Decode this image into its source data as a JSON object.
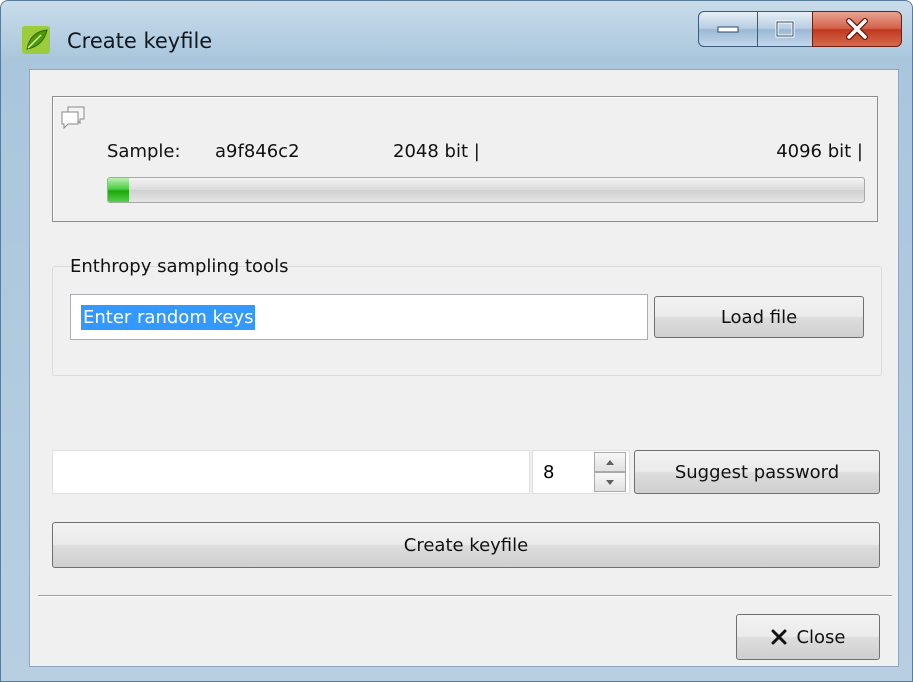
{
  "window": {
    "title": "Create keyfile",
    "app_icon": "green-leaf-icon",
    "controls": {
      "minimize": "minimize-icon",
      "maximize": "maximize-icon",
      "close": "close-icon"
    }
  },
  "sample": {
    "label": "Sample:",
    "value": "a9f846c2",
    "marker_low": "2048 bit |",
    "marker_high": "4096 bit |",
    "progress_fraction": 0.028,
    "icon": "chat-bubble-icon"
  },
  "entropy": {
    "group_title": "Enthropy sampling tools",
    "input_value": "Enter random keys",
    "load_button": "Load file"
  },
  "password": {
    "value": "",
    "length": "8",
    "suggest_button": "Suggest password"
  },
  "actions": {
    "create_button": "Create keyfile",
    "close_button": "Close"
  }
}
